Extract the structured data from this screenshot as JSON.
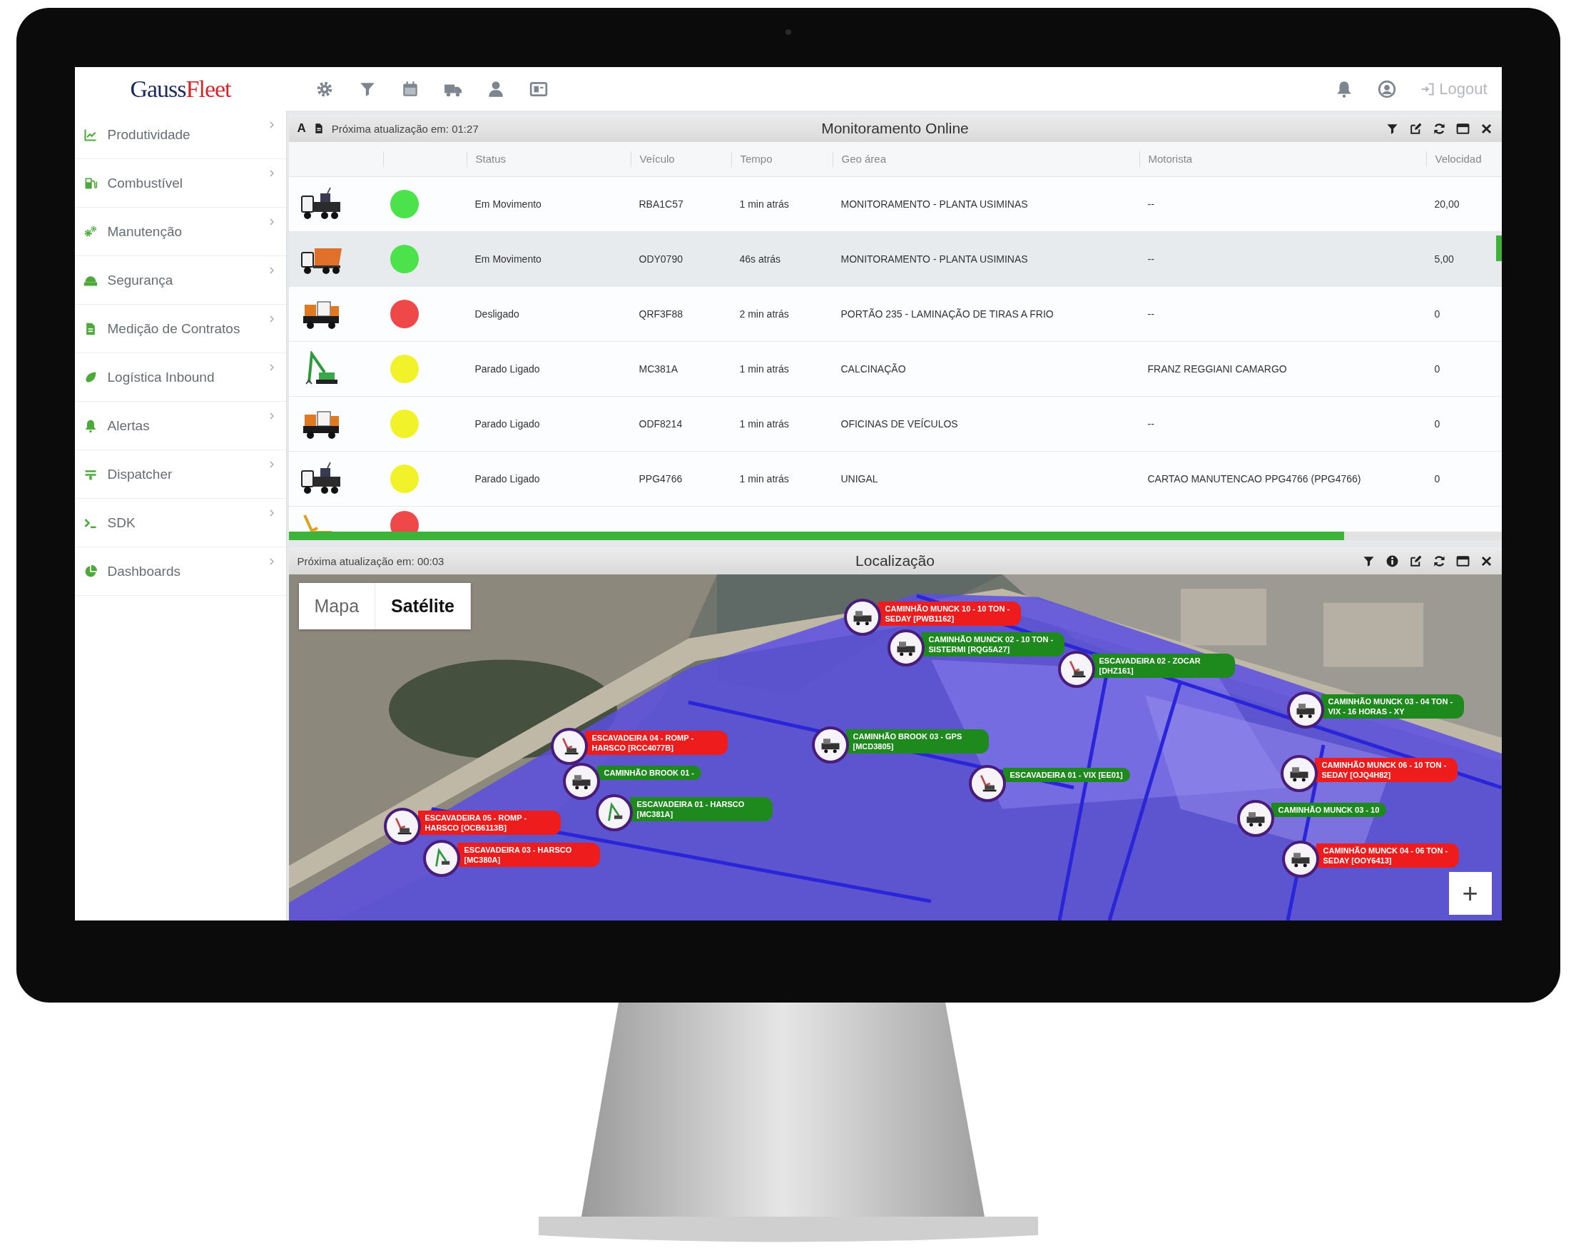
{
  "brand": {
    "part_1": "Gauss",
    "part_2": "Fleet"
  },
  "topbar": {
    "logout": "Logout"
  },
  "sidebar": {
    "items": [
      {
        "label": "Produtividade"
      },
      {
        "label": "Combustível"
      },
      {
        "label": "Manutenção"
      },
      {
        "label": "Segurança"
      },
      {
        "label": "Medição de Contratos"
      },
      {
        "label": "Logística Inbound"
      },
      {
        "label": "Alertas"
      },
      {
        "label": "Dispatcher"
      },
      {
        "label": "SDK"
      },
      {
        "label": "Dashboards"
      }
    ]
  },
  "panel_monitor": {
    "font_button": "A",
    "update_text": "Próxima atualização em: 01:27",
    "title": "Monitoramento Online",
    "columns": [
      "Status",
      "Veículo",
      "Tempo",
      "Geo área",
      "Motorista",
      "Velocidad"
    ],
    "rows": [
      {
        "kind": "truck",
        "color": "#4ce24c",
        "selected": false,
        "status": "Em Movimento",
        "vehicle": "RBA1C57",
        "time": "1 min atrás",
        "geo_area": "MONITORAMENTO - PLANTA USIMINAS",
        "driver": "--",
        "speed": "20,00"
      },
      {
        "kind": "dump-truck",
        "color": "#4ce24c",
        "selected": true,
        "status": "Em Movimento",
        "vehicle": "ODY0790",
        "time": "46s atrás",
        "geo_area": "MONITORAMENTO - PLANTA USIMINAS",
        "driver": "--",
        "speed": "5,00"
      },
      {
        "kind": "loader",
        "color": "#ee4848",
        "selected": false,
        "status": "Desligado",
        "vehicle": "QRF3F88",
        "time": "2 min atrás",
        "geo_area": "PORTÃO 235 - LAMINAÇÃO DE TIRAS A FRIO",
        "driver": "--",
        "speed": "0"
      },
      {
        "kind": "material-handler",
        "color": "#f2f22a",
        "selected": false,
        "status": "Parado Ligado",
        "vehicle": "MC381A",
        "time": "1 min atrás",
        "geo_area": "CALCINAÇÃO",
        "driver": "FRANZ REGGIANI CAMARGO",
        "speed": "0"
      },
      {
        "kind": "loader",
        "color": "#f2f22a",
        "selected": false,
        "status": "Parado Ligado",
        "vehicle": "ODF8214",
        "time": "1 min atrás",
        "geo_area": "OFICINAS DE VEÍCULOS",
        "driver": "--",
        "speed": "0"
      },
      {
        "kind": "truck",
        "color": "#f2f22a",
        "selected": false,
        "status": "Parado Ligado",
        "vehicle": "PPG4766",
        "time": "1 min atrás",
        "geo_area": "UNIGAL",
        "driver": "CARTAO MANUTENCAO PPG4766 (PPG4766)",
        "speed": "0"
      },
      {
        "kind": "excavator",
        "color": "#ee4848",
        "selected": false
      }
    ]
  },
  "panel_map": {
    "update_text": "Próxima atualização em: 00:03",
    "title": "Localização",
    "map": {
      "kind": "picture",
      "map_types": [
        {
          "label": "Mapa",
          "selected": false
        },
        {
          "label": "Satélite",
          "selected": true
        }
      ],
      "zoom_in": "+",
      "markers": [
        {
          "kind": "truck",
          "color": "#ee1c1c",
          "label": "CAMINHÃO MUNCK 10 - 10 TON - SEDAY [PWB1162]"
        },
        {
          "kind": "truck",
          "color": "#1e8a1e",
          "label": "CAMINHÃO MUNCK 02 - 10 TON - SISTERMI [RQG5A27]"
        },
        {
          "kind": "excavator",
          "color": "#1e8a1e",
          "label": "ESCAVADEIRA 02 - ZOCAR [DHZ161]"
        },
        {
          "kind": "truck",
          "color": "#1e8a1e",
          "label": "CAMINHÃO MUNCK 03 - 04 TON - VIX - 16 HORAS - XY"
        },
        {
          "kind": "excavator",
          "color": "#ee1c1c",
          "label": "ESCAVADEIRA 04 - ROMP - HARSCO [RCC4077B]"
        },
        {
          "kind": "truck",
          "color": "#1e8a1e",
          "label": "CAMINHÃO BROOK 03 - GPS [MCD3805]"
        },
        {
          "kind": "truck",
          "color": "#1e8a1e",
          "label": "CAMINHÃO BROOK 01 -"
        },
        {
          "kind": "excavator",
          "color": "#1e8a1e",
          "label": "ESCAVADEIRA 01 - VIX [EE01]"
        },
        {
          "kind": "truck",
          "color": "#ee1c1c",
          "label": "CAMINHÃO MUNCK 06 - 10 TON - SEDAY [OJQ4H82]"
        },
        {
          "kind": "handler",
          "color": "#1e8a1e",
          "label": "ESCAVADEIRA 01 - HARSCO [MC381A]"
        },
        {
          "kind": "excavator",
          "color": "#ee1c1c",
          "label": "ESCAVADEIRA 05 - ROMP - HARSCO [OCB6113B]"
        },
        {
          "kind": "handler",
          "color": "#ee1c1c",
          "label": "ESCAVADEIRA 03 - HARSCO [MC380A]"
        },
        {
          "kind": "truck",
          "color": "#1e8a1e",
          "label": "CAMINHÃO MUNCK 03 - 10"
        },
        {
          "kind": "truck",
          "color": "#ee1c1c",
          "label": "CAMINHÃO MUNCK 04 - 06 TON - SEDAY [OOY6413]"
        }
      ]
    }
  }
}
